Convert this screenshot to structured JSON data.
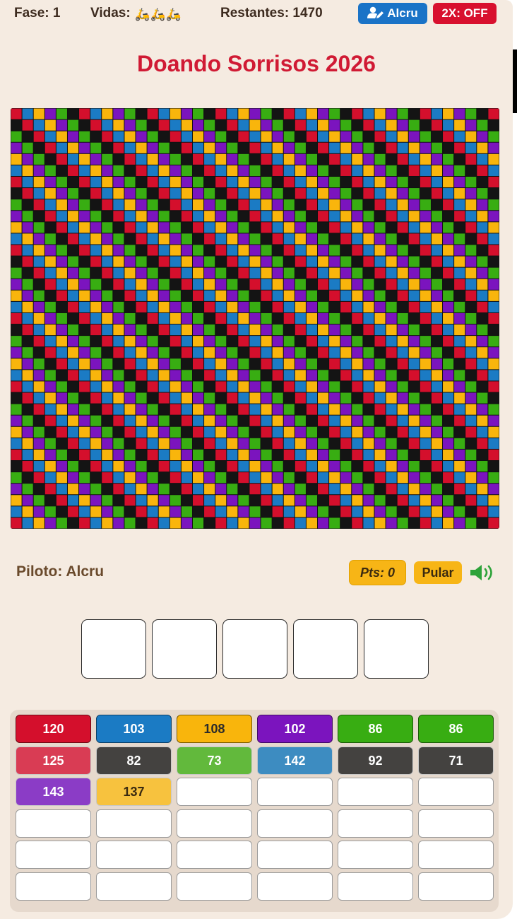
{
  "header": {
    "phase_label": "Fase: 1",
    "lives_label": "Vidas:",
    "lives_icon": "scooter-icon",
    "lives_count": 3,
    "lives_glyph": "🛵",
    "remaining_label": "Restantes: 1470",
    "user_button_label": "Alcru",
    "user_button_icon": "user-edit-icon",
    "double_button_label": "2X: OFF"
  },
  "title": "Doando Sorrisos 2026",
  "board": {
    "cols": 43,
    "rows": 37,
    "colors": {
      "red": "#d40f2c",
      "blue": "#1b7bc4",
      "yellow": "#f9b50c",
      "purple": "#7b14be",
      "green": "#38ad12",
      "black": "#141414"
    },
    "palette_order": [
      "red",
      "blue",
      "yellow",
      "purple",
      "green",
      "black"
    ]
  },
  "status": {
    "pilot_label": "Piloto: Alcru",
    "points_label": "Pts: 0",
    "skip_label": "Pular",
    "sound_icon": "speaker-volume-icon"
  },
  "answer_slots": [
    "",
    "",
    "",
    "",
    ""
  ],
  "color_counts": [
    [
      {
        "value": "120",
        "color": "#d40f2c",
        "text_color": "#ffffff",
        "border": "#6b0a14"
      },
      {
        "value": "103",
        "color": "#1b7bc4",
        "text_color": "#ffffff",
        "border": "#0b3f66"
      },
      {
        "value": "108",
        "color": "#f9b50c",
        "text_color": "#2b2b2b",
        "border": "#7a5a00"
      },
      {
        "value": "102",
        "color": "#7b14be",
        "text_color": "#ffffff",
        "border": "#3f0a63"
      },
      {
        "value": "86",
        "color": "#38ad12",
        "text_color": "#ffffff",
        "border": "#1b5a08"
      },
      {
        "value": "86",
        "color": "#38ad12",
        "text_color": "#ffffff",
        "border": "#1b5a08"
      }
    ],
    [
      {
        "value": "125",
        "color": "#d93c54",
        "text_color": "#ffffff",
        "border": "#c8c8c8"
      },
      {
        "value": "82",
        "color": "#444240",
        "text_color": "#ffffff",
        "border": "#c8c8c8"
      },
      {
        "value": "73",
        "color": "#62b93c",
        "text_color": "#ffffff",
        "border": "#c8c8c8"
      },
      {
        "value": "142",
        "color": "#3d8cc1",
        "text_color": "#ffffff",
        "border": "#c8c8c8"
      },
      {
        "value": "92",
        "color": "#444240",
        "text_color": "#ffffff",
        "border": "#c8c8c8"
      },
      {
        "value": "71",
        "color": "#444240",
        "text_color": "#ffffff",
        "border": "#c8c8c8"
      }
    ],
    [
      {
        "value": "143",
        "color": "#8b3cc6",
        "text_color": "#ffffff",
        "border": "#c8c8c8"
      },
      {
        "value": "137",
        "color": "#f7c23e",
        "text_color": "#3a2a10",
        "border": "#c8c8c8"
      },
      {
        "value": "",
        "color": "#ffffff",
        "text_color": "#000000",
        "border": "#9a9a9a"
      },
      {
        "value": "",
        "color": "#ffffff",
        "text_color": "#000000",
        "border": "#9a9a9a"
      },
      {
        "value": "",
        "color": "#ffffff",
        "text_color": "#000000",
        "border": "#9a9a9a"
      },
      {
        "value": "",
        "color": "#ffffff",
        "text_color": "#000000",
        "border": "#9a9a9a"
      }
    ],
    [
      {
        "value": "",
        "color": "#ffffff",
        "text_color": "#000000",
        "border": "#9a9a9a"
      },
      {
        "value": "",
        "color": "#ffffff",
        "text_color": "#000000",
        "border": "#9a9a9a"
      },
      {
        "value": "",
        "color": "#ffffff",
        "text_color": "#000000",
        "border": "#9a9a9a"
      },
      {
        "value": "",
        "color": "#ffffff",
        "text_color": "#000000",
        "border": "#9a9a9a"
      },
      {
        "value": "",
        "color": "#ffffff",
        "text_color": "#000000",
        "border": "#9a9a9a"
      },
      {
        "value": "",
        "color": "#ffffff",
        "text_color": "#000000",
        "border": "#9a9a9a"
      }
    ],
    [
      {
        "value": "",
        "color": "#ffffff",
        "text_color": "#000000",
        "border": "#9a9a9a"
      },
      {
        "value": "",
        "color": "#ffffff",
        "text_color": "#000000",
        "border": "#9a9a9a"
      },
      {
        "value": "",
        "color": "#ffffff",
        "text_color": "#000000",
        "border": "#9a9a9a"
      },
      {
        "value": "",
        "color": "#ffffff",
        "text_color": "#000000",
        "border": "#9a9a9a"
      },
      {
        "value": "",
        "color": "#ffffff",
        "text_color": "#000000",
        "border": "#9a9a9a"
      },
      {
        "value": "",
        "color": "#ffffff",
        "text_color": "#000000",
        "border": "#9a9a9a"
      }
    ],
    [
      {
        "value": "",
        "color": "#ffffff",
        "text_color": "#000000",
        "border": "#9a9a9a"
      },
      {
        "value": "",
        "color": "#ffffff",
        "text_color": "#000000",
        "border": "#9a9a9a"
      },
      {
        "value": "",
        "color": "#ffffff",
        "text_color": "#000000",
        "border": "#9a9a9a"
      },
      {
        "value": "",
        "color": "#ffffff",
        "text_color": "#000000",
        "border": "#9a9a9a"
      },
      {
        "value": "",
        "color": "#ffffff",
        "text_color": "#000000",
        "border": "#9a9a9a"
      },
      {
        "value": "",
        "color": "#ffffff",
        "text_color": "#000000",
        "border": "#9a9a9a"
      }
    ]
  ]
}
